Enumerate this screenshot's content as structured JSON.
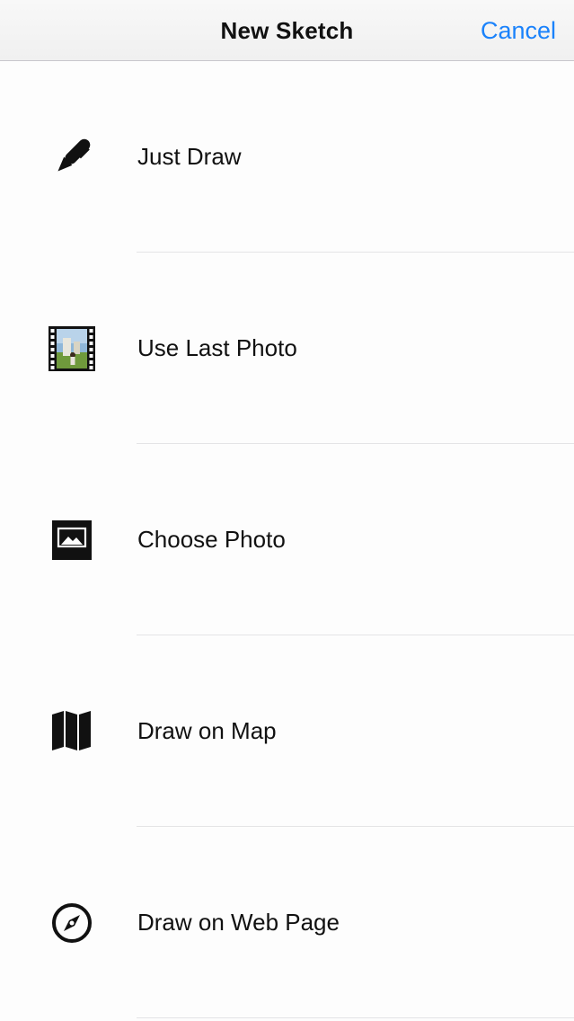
{
  "navbar": {
    "title": "New Sketch",
    "cancel_label": "Cancel"
  },
  "colors": {
    "accent": "#1a82fb",
    "background": "#fdfdfd",
    "separator": "#e4e4e6"
  },
  "options": [
    {
      "label": "Just Draw",
      "icon": "pen-icon"
    },
    {
      "label": "Use Last Photo",
      "icon": "photo-filmstrip-icon"
    },
    {
      "label": "Choose Photo",
      "icon": "photo-icon"
    },
    {
      "label": "Draw on Map",
      "icon": "map-icon"
    },
    {
      "label": "Draw on Web Page",
      "icon": "compass-icon"
    }
  ]
}
